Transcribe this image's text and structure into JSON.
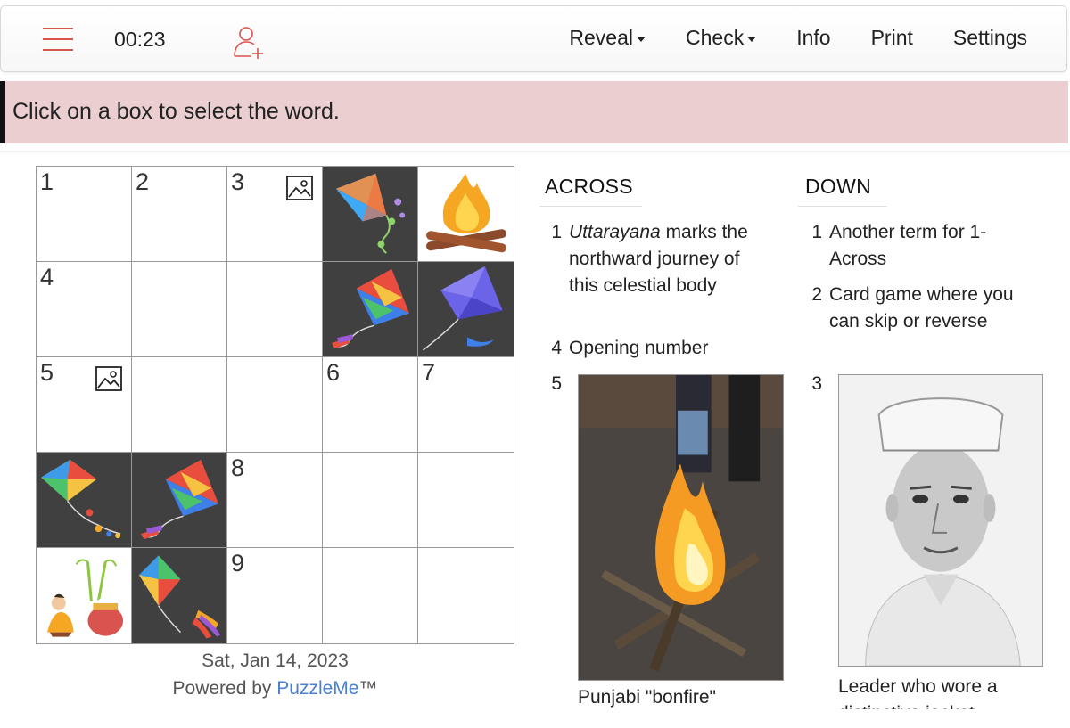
{
  "toolbar": {
    "timer": "00:23",
    "reveal_label": "Reveal",
    "check_label": "Check",
    "info_label": "Info",
    "print_label": "Print",
    "settings_label": "Settings",
    "accent_color": "#d9534f"
  },
  "message": "Click on a box to select the word.",
  "grid": {
    "numbers": {
      "c00": "1",
      "c01": "2",
      "c02": "3",
      "c10": "4",
      "c20": "5",
      "c23": "6",
      "c24": "7",
      "c32": "8",
      "c42": "9"
    },
    "image_clue_icon": "image-icon",
    "shaded_cell_color": "#404040"
  },
  "footer": {
    "date": "Sat, Jan 14, 2023",
    "powered_prefix": "Powered by ",
    "powered_link": "PuzzleMe",
    "powered_suffix": "™"
  },
  "across": {
    "heading": "ACROSS",
    "clues": [
      {
        "num": "1",
        "text_em": "Uttarayana",
        "text": " marks the northward journey of this celestial body"
      },
      {
        "num": "4",
        "text": "Opening number"
      },
      {
        "num": "5",
        "caption": "Punjabi \"bonfire\""
      }
    ]
  },
  "down": {
    "heading": "DOWN",
    "clues": [
      {
        "num": "1",
        "text": "Another term for 1-Across"
      },
      {
        "num": "2",
        "text": "Card game where you can skip or reverse"
      },
      {
        "num": "3",
        "caption": "Leader who wore a distinctive jacket"
      }
    ]
  }
}
